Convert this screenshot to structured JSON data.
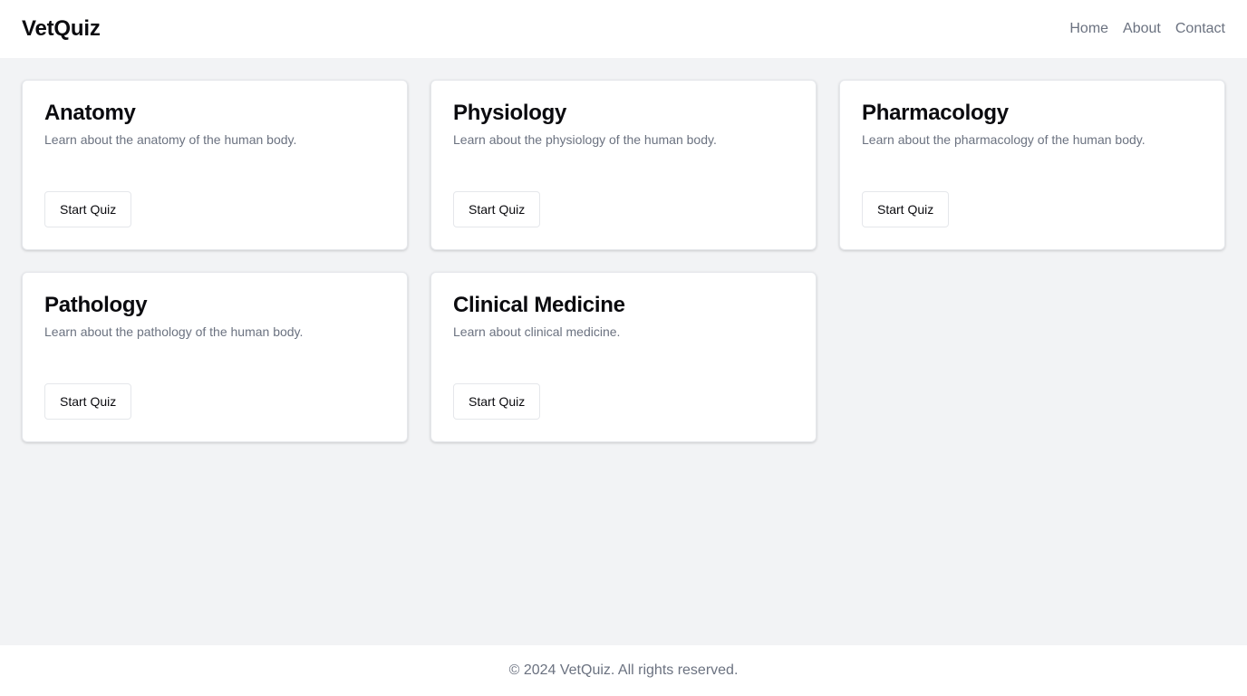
{
  "header": {
    "brand": "VetQuiz",
    "nav": [
      {
        "label": "Home"
      },
      {
        "label": "About"
      },
      {
        "label": "Contact"
      }
    ]
  },
  "quizzes": [
    {
      "title": "Anatomy",
      "description": "Learn about the anatomy of the human body.",
      "button": "Start Quiz"
    },
    {
      "title": "Physiology",
      "description": "Learn about the physiology of the human body.",
      "button": "Start Quiz"
    },
    {
      "title": "Pharmacology",
      "description": "Learn about the pharmacology of the human body.",
      "button": "Start Quiz"
    },
    {
      "title": "Pathology",
      "description": "Learn about the pathology of the human body.",
      "button": "Start Quiz"
    },
    {
      "title": "Clinical Medicine",
      "description": "Learn about clinical medicine.",
      "button": "Start Quiz"
    }
  ],
  "footer": {
    "text": "© 2024 VetQuiz. All rights reserved."
  },
  "colors": {
    "page_background": "#f2f3f5",
    "surface": "#ffffff",
    "muted_text": "#6b7280",
    "heading_text": "#0b0b0f"
  }
}
